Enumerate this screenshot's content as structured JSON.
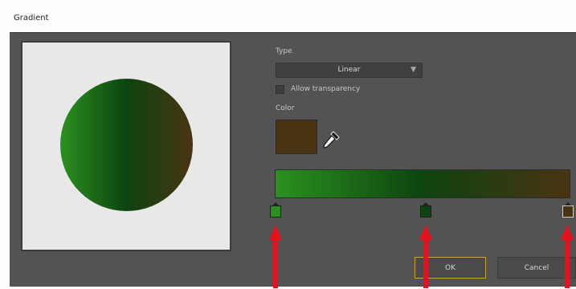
{
  "window": {
    "title": "Gradient"
  },
  "preview": {
    "colors": [
      "#2a9120",
      "#0e4410",
      "#4a3312"
    ]
  },
  "type": {
    "label": "Type",
    "value": "Linear"
  },
  "transparency": {
    "label": "Allow transparency",
    "checked": false
  },
  "color": {
    "label": "Color",
    "swatch": "#4a3312",
    "eyedropper_icon": "eyedropper-icon"
  },
  "gradient": {
    "stops": [
      {
        "color": "#2a9120",
        "position": 0.0,
        "selected": false
      },
      {
        "color": "#0e4410",
        "position": 0.5,
        "selected": false
      },
      {
        "color": "#4a3312",
        "position": 1.0,
        "selected": true
      }
    ]
  },
  "buttons": {
    "ok": "OK",
    "cancel": "Cancel"
  },
  "annotations": {
    "arrow_color": "#e8101c",
    "count": 3
  }
}
